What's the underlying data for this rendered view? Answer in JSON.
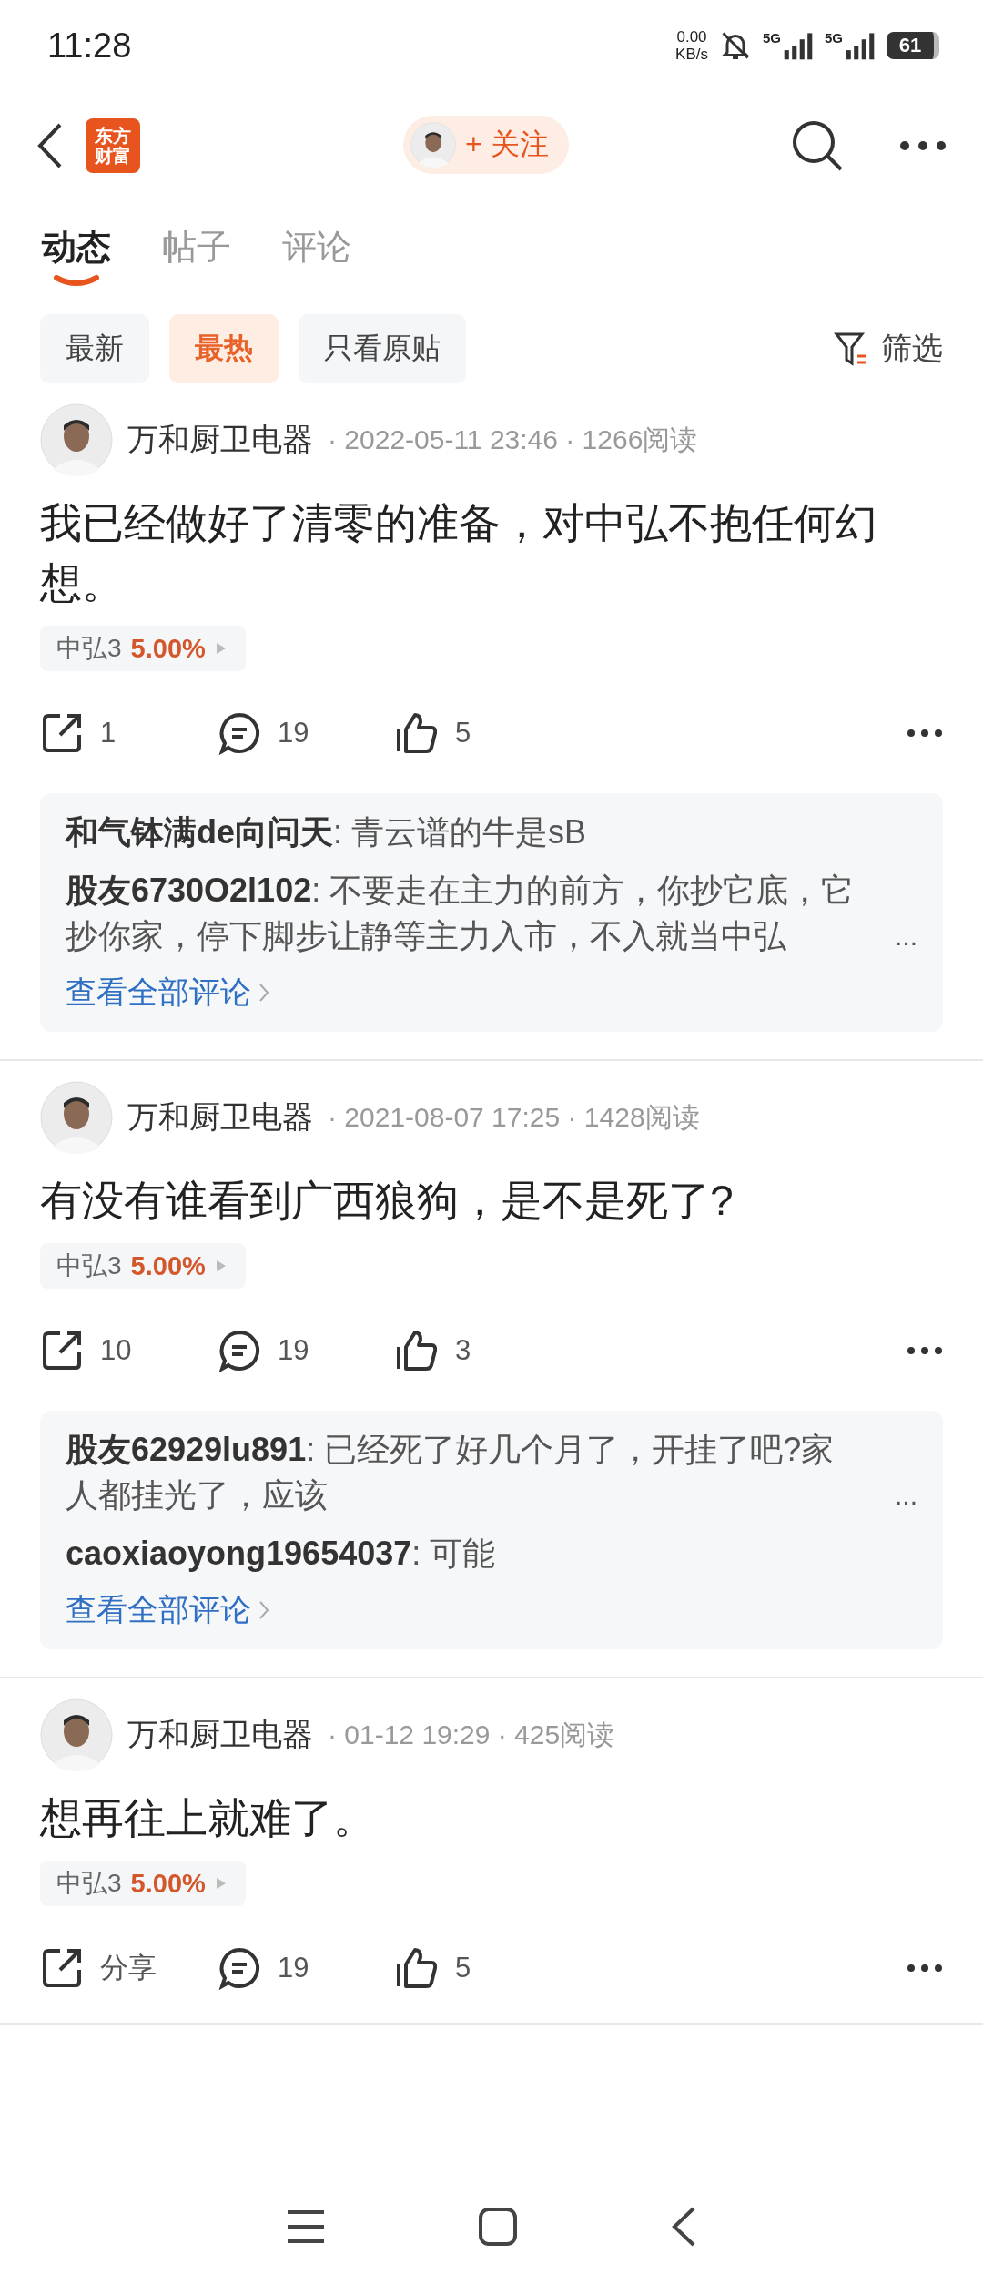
{
  "status_bar": {
    "time": "11:28",
    "net_speed": [
      "0.00",
      "KB/s"
    ],
    "networks": [
      "5G",
      "5G"
    ],
    "battery": "61"
  },
  "header": {
    "logo_text": [
      "东方",
      "财富"
    ],
    "follow_button": "+ 关注"
  },
  "tabs": [
    {
      "label": "动态",
      "selected": true
    },
    {
      "label": "帖子",
      "selected": false
    },
    {
      "label": "评论",
      "selected": false
    }
  ],
  "filters": [
    {
      "label": "最新",
      "selected": false
    },
    {
      "label": "最热",
      "selected": true
    },
    {
      "label": "只看原贴",
      "selected": false
    }
  ],
  "filter_button": "筛选",
  "posts": [
    {
      "author": "万和厨卫电器",
      "meta": "· 2022-05-11 23:46 · 1266阅读",
      "text": "我已经做好了清零的准备，对中弘不抱任何幻想。",
      "stock": {
        "name": "中弘3",
        "change": "5.00%"
      },
      "actions": {
        "share": "1",
        "comments": "19",
        "likes": "5"
      },
      "comments": [
        {
          "text": "**和气钵满de向问天**: 青云谱的牛是sB"
        },
        {
          "text": "**股友6730O2l102**: 不要走在主力的前方，你抄它底，它抄你家，停下脚步让静等主力入市，不入就当中弘",
          "ellipsis": "..."
        }
      ],
      "view_all": "查看全部评论"
    },
    {
      "author": "万和厨卫电器",
      "meta": "· 2021-08-07 17:25 · 1428阅读",
      "text": "有没有谁看到广西狼狗，是不是死了?",
      "stock": {
        "name": "中弘3",
        "change": "5.00%"
      },
      "actions": {
        "share": "10",
        "comments": "19",
        "likes": "3"
      },
      "comments": [
        {
          "text": "**股友62929lu891**: 已经死了好几个月了，开挂了吧?家人都挂光了，应该",
          "ellipsis": "..."
        },
        {
          "text": "**caoxiaoyong19654037**: 可能"
        }
      ],
      "view_all": "查看全部评论"
    },
    {
      "author": "万和厨卫电器",
      "meta": "· 01-12 19:29 · 425阅读",
      "text": "想再往上就难了。",
      "stock": {
        "name": "中弘3",
        "change": "5.00%"
      },
      "actions": {
        "share": "分享",
        "comments": "19",
        "likes": "5"
      }
    }
  ]
}
